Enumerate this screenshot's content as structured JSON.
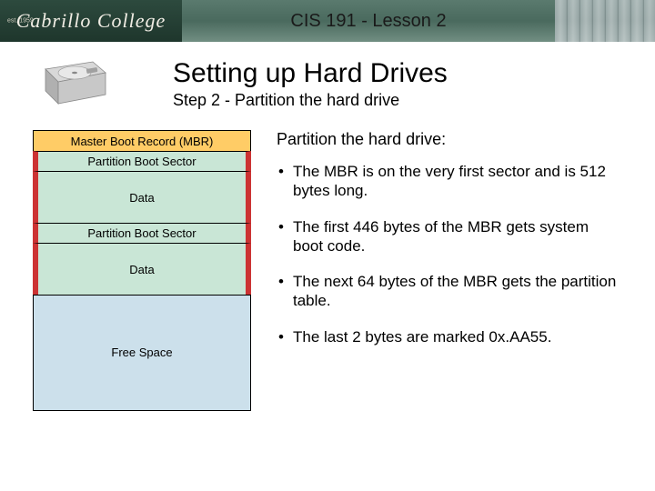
{
  "header": {
    "logo_text": "Cabrillo College",
    "logo_sub": "est. 1959",
    "course_title": "CIS 191 - Lesson 2"
  },
  "page": {
    "title": "Setting up Hard Drives",
    "subtitle": "Step 2 - Partition the hard drive"
  },
  "diagram": {
    "mbr": "Master Boot Record (MBR)",
    "pbs1": "Partition Boot Sector",
    "data1": "Data",
    "pbs2": "Partition Boot Sector",
    "data2": "Data",
    "free": "Free Space"
  },
  "notes": {
    "heading": "Partition the hard drive:",
    "bullets": [
      "The MBR is on the very first sector and is 512 bytes long.",
      "The first 446 bytes of the MBR gets system boot code.",
      "The next 64 bytes of the MBR gets the partition table.",
      "The last 2 bytes are marked 0x.AA55."
    ]
  },
  "colors": {
    "mbr_fill": "#ffcc66",
    "partition_fill": "#c9e6d6",
    "partition_border": "#cc3333",
    "free_fill": "#cce0eb"
  }
}
